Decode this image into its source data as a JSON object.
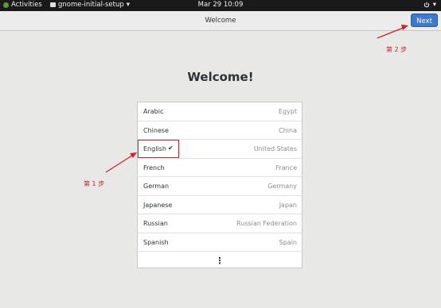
{
  "topbar": {
    "activities": "Activities",
    "app_menu": "gnome-initial-setup",
    "clock": "Mar 29 10:09"
  },
  "header": {
    "title": "Welcome",
    "next_label": "Next"
  },
  "main": {
    "heading": "Welcome!"
  },
  "languages": [
    {
      "name": "Arabic",
      "region": "Egypt",
      "selected": false
    },
    {
      "name": "Chinese",
      "region": "China",
      "selected": false
    },
    {
      "name": "English",
      "region": "United States",
      "selected": true
    },
    {
      "name": "French",
      "region": "France",
      "selected": false
    },
    {
      "name": "German",
      "region": "Germany",
      "selected": false
    },
    {
      "name": "Japanese",
      "region": "Japan",
      "selected": false
    },
    {
      "name": "Russian",
      "region": "Russian Federation",
      "selected": false
    },
    {
      "name": "Spanish",
      "region": "Spain",
      "selected": false
    }
  ],
  "check_glyph": "✔",
  "more_glyph": "⋮",
  "annotations": {
    "step1": "第 1 步",
    "step2": "第 2 步"
  },
  "colors": {
    "accent": "#3b7ad1",
    "annotation": "#d0232a",
    "topbar": "#1a1a1a"
  }
}
